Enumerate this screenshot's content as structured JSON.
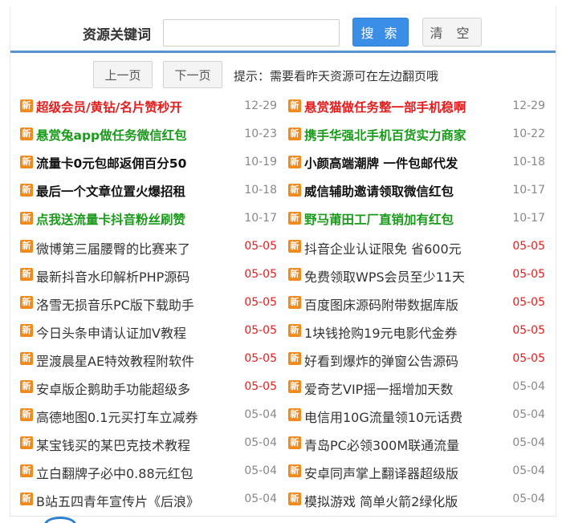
{
  "search": {
    "label": "资源关键词",
    "value": "",
    "placeholder": "",
    "search_label": "搜 索",
    "clear_label": "清 空"
  },
  "pager": {
    "prev_label": "上一页",
    "next_label": "下一页",
    "hint": "提示：需要看昨天资源可在左边翻页哦"
  },
  "colors": {
    "red": "#e02020",
    "green": "#1a9a1a",
    "black": "#111111",
    "normal": "#333333",
    "accent": "#3a8ee6",
    "badge": "#f08a1c"
  },
  "badge_label": "新",
  "left_items": [
    {
      "title": "超级会员/黄钻/名片赞秒开",
      "date": "12-29",
      "style": "red"
    },
    {
      "title": "悬赏兔app做任务微信红包",
      "date": "10-23",
      "style": "green"
    },
    {
      "title": "流量卡0元包邮返佣百分50",
      "date": "10-19",
      "style": "black"
    },
    {
      "title": "最后一个文章位置火爆招租",
      "date": "10-18",
      "style": "black"
    },
    {
      "title": "点我送流量卡抖音粉丝刷赞",
      "date": "10-17",
      "style": "green"
    },
    {
      "title": "微博第三届腰臀的比赛来了",
      "date": "05-05",
      "style": "normal",
      "hot": true
    },
    {
      "title": "最新抖音水印解析PHP源码",
      "date": "05-05",
      "style": "normal",
      "hot": true
    },
    {
      "title": "洛雪无损音乐PC版下载助手",
      "date": "05-05",
      "style": "normal",
      "hot": true
    },
    {
      "title": "今日头条申请认证加V教程",
      "date": "05-05",
      "style": "normal",
      "hot": true
    },
    {
      "title": "罡渡晨星AE特效教程附软件",
      "date": "05-05",
      "style": "normal",
      "hot": true
    },
    {
      "title": "安卓版企鹅助手功能超级多",
      "date": "05-05",
      "style": "normal",
      "hot": true
    },
    {
      "title": "高德地图0.1元买打车立减券",
      "date": "05-04",
      "style": "normal"
    },
    {
      "title": "某宝钱买的某巴克技术教程",
      "date": "05-04",
      "style": "normal"
    },
    {
      "title": "立白翻牌子必中0.88元红包",
      "date": "05-04",
      "style": "normal"
    },
    {
      "title": "B站五四青年宣传片《后浪》",
      "date": "05-04",
      "style": "normal"
    }
  ],
  "right_items": [
    {
      "title": "悬赏猫做任务整一部手机稳啊",
      "date": "12-29",
      "style": "red"
    },
    {
      "title": "携手华强北手机百货实力商家",
      "date": "10-22",
      "style": "green"
    },
    {
      "title": "小颜高端潮牌 一件包邮代发",
      "date": "10-18",
      "style": "black"
    },
    {
      "title": "威信辅助邀请领取微信红包",
      "date": "10-17",
      "style": "black"
    },
    {
      "title": "野马莆田工厂直销加有红包",
      "date": "10-17",
      "style": "green"
    },
    {
      "title": "抖音企业认证限免 省600元",
      "date": "05-05",
      "style": "normal",
      "hot": true
    },
    {
      "title": "免费领取WPS会员至少11天",
      "date": "05-05",
      "style": "normal",
      "hot": true
    },
    {
      "title": "百度图床源码附带数据库版",
      "date": "05-05",
      "style": "normal",
      "hot": true
    },
    {
      "title": "1块钱抢购19元电影代金券",
      "date": "05-05",
      "style": "normal",
      "hot": true
    },
    {
      "title": "好看到爆炸的弹窗公告源码",
      "date": "05-05",
      "style": "normal",
      "hot": true
    },
    {
      "title": "爱奇艺VIP摇一摇增加天数",
      "date": "05-04",
      "style": "normal"
    },
    {
      "title": "电信用10G流量领10元话费",
      "date": "05-04",
      "style": "normal"
    },
    {
      "title": "青岛PC必领300M联通流量",
      "date": "05-04",
      "style": "normal"
    },
    {
      "title": "安卓同声掌上翻译器超级版",
      "date": "05-04",
      "style": "normal"
    },
    {
      "title": "模拟游戏 简单火箭2绿化版",
      "date": "05-04",
      "style": "normal"
    }
  ]
}
